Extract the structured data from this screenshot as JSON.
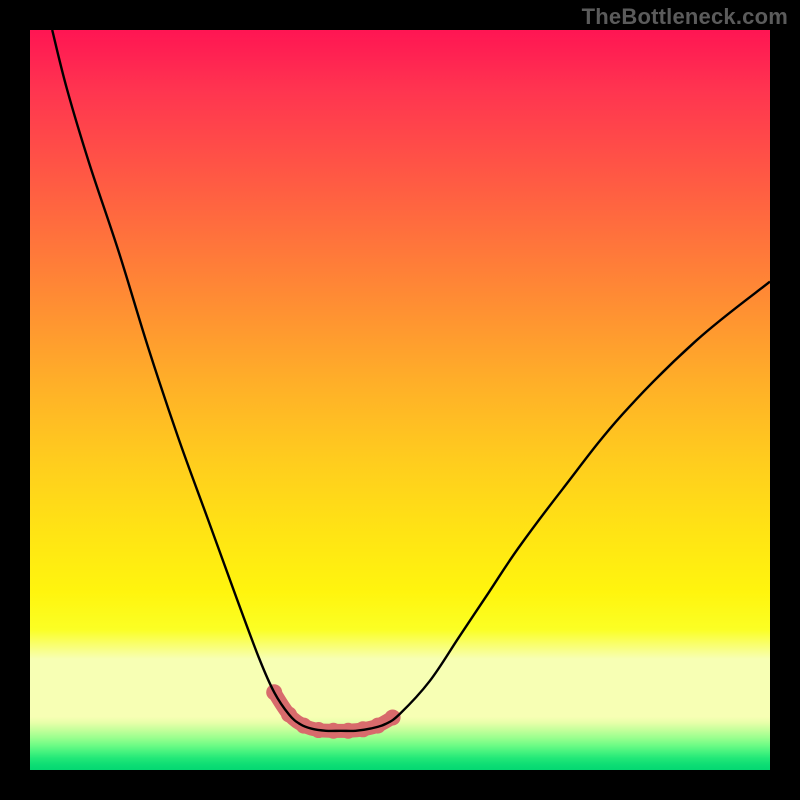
{
  "watermark": "TheBottleneck.com",
  "colors": {
    "frame": "#000000",
    "curve": "#000000",
    "thick_segment": "#d86b6c",
    "gradient_top": "#ff1553",
    "gradient_mid": "#ffe414",
    "gradient_pale": "#f7ffb4",
    "gradient_bottom": "#04d872"
  },
  "chart_data": {
    "type": "line",
    "title": "",
    "xlabel": "",
    "ylabel": "",
    "xlim": [
      0,
      100
    ],
    "ylim": [
      0,
      100
    ],
    "series": [
      {
        "name": "bottleneck-curve",
        "x": [
          3,
          5,
          8,
          12,
          16,
          20,
          24,
          28,
          31,
          33,
          35,
          36.5,
          38,
          40,
          42,
          44,
          46,
          48,
          50,
          54,
          58,
          62,
          66,
          72,
          80,
          90,
          100
        ],
        "y": [
          100,
          92,
          82,
          70,
          57,
          45,
          34,
          23,
          15,
          10.5,
          7.5,
          6.2,
          5.6,
          5.3,
          5.3,
          5.3,
          5.6,
          6.2,
          7.6,
          12,
          18,
          24,
          30,
          38,
          48,
          58,
          66
        ]
      }
    ],
    "thick_segment": {
      "name": "optimal-range",
      "x": [
        33,
        35,
        37,
        39,
        41,
        43,
        45,
        47,
        49
      ],
      "y": [
        10.5,
        7.5,
        6.0,
        5.4,
        5.3,
        5.3,
        5.5,
        6.0,
        7.1
      ]
    },
    "markers": {
      "name": "optimal-markers",
      "x": [
        33,
        35,
        37,
        39,
        41,
        43,
        45,
        47,
        49
      ],
      "y": [
        10.5,
        7.5,
        6.0,
        5.4,
        5.3,
        5.3,
        5.5,
        6.0,
        7.1
      ]
    }
  }
}
